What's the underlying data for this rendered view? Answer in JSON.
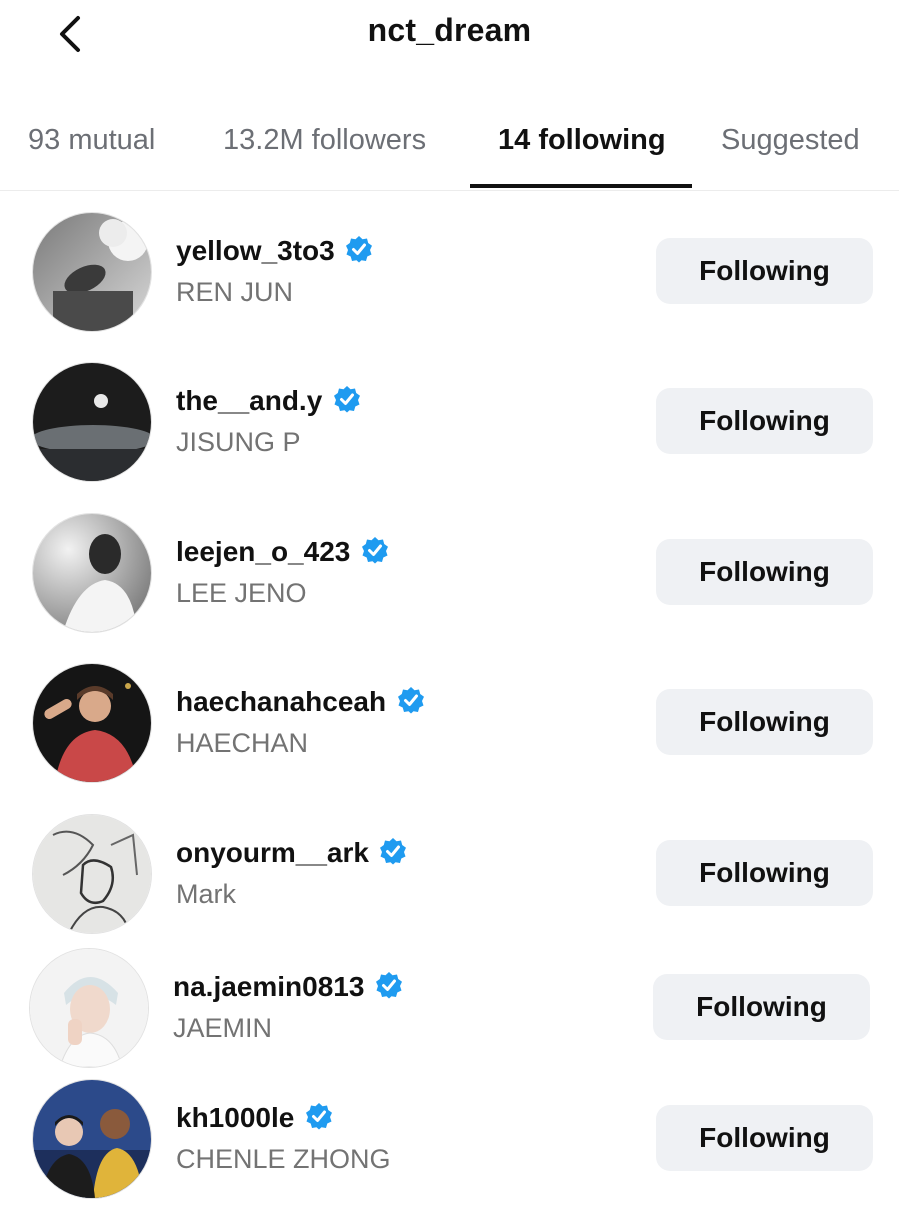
{
  "header": {
    "title": "nct_dream",
    "back_icon": "chevron-left-icon"
  },
  "tabs": [
    {
      "label": "93 mutual",
      "active": false
    },
    {
      "label": "13.2M followers",
      "active": false
    },
    {
      "label": "14 following",
      "active": true
    },
    {
      "label": "Suggested",
      "active": false
    }
  ],
  "colors": {
    "verified_badge": "#1f9bf0",
    "button_bg": "#eff1f4",
    "secondary_text": "#737373"
  },
  "following": [
    {
      "username": "yellow_3to3",
      "full_name": "REN JUN",
      "verified": true,
      "button_label": "Following"
    },
    {
      "username": "the__and.y",
      "full_name": "JISUNG P",
      "verified": true,
      "button_label": "Following"
    },
    {
      "username": "leejen_o_423",
      "full_name": "LEE JENO",
      "verified": true,
      "button_label": "Following"
    },
    {
      "username": "haechanahceah",
      "full_name": "HAECHAN",
      "verified": true,
      "button_label": "Following"
    },
    {
      "username": "onyourm__ark",
      "full_name": "Mark",
      "verified": true,
      "button_label": "Following"
    },
    {
      "username": "na.jaemin0813",
      "full_name": "JAEMIN",
      "verified": true,
      "button_label": "Following"
    },
    {
      "username": "kh1000le",
      "full_name": "CHENLE ZHONG",
      "verified": true,
      "button_label": "Following"
    }
  ]
}
